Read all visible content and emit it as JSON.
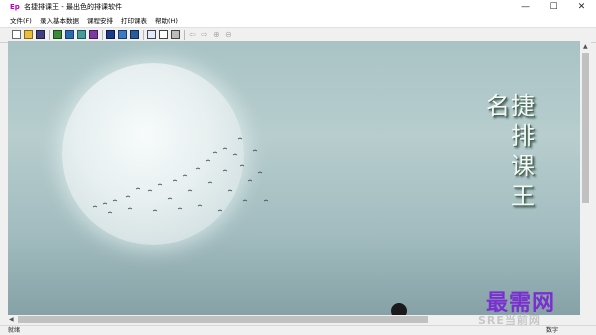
{
  "window": {
    "app_icon_text": "Ep",
    "title": "名捷排课王 - 最出色的排课软件",
    "minimize": "—",
    "maximize": "☐",
    "close": "✕"
  },
  "menu": {
    "items": [
      "文件(F)",
      "录入基本数据",
      "课程安排",
      "打印课表",
      "帮助(H)"
    ]
  },
  "toolbar": {
    "icons": [
      "new-file-icon",
      "open-folder-icon",
      "save-icon",
      "teacher-icon",
      "class-icon",
      "course-icon",
      "room-icon",
      "schedule-icon",
      "adjust-icon",
      "export-icon",
      "view-icon",
      "preview-icon",
      "print-icon",
      "back-arrow-icon",
      "forward-arrow-icon",
      "zoom-in-icon",
      "zoom-out-icon"
    ]
  },
  "canvas": {
    "poem_col_left": [
      "名",
      "捷"
    ],
    "poem_col_right": [
      "排",
      "课",
      "王"
    ]
  },
  "status": {
    "left": "就绪",
    "right": "数字"
  },
  "watermark": {
    "main": "最需网",
    "sub": "SRE当前网"
  },
  "colors": {
    "sky_top": "#a9c3c5",
    "sky_bottom": "#86a2a6",
    "moon": "#e7eff0",
    "watermark": "#7a2fd0"
  }
}
